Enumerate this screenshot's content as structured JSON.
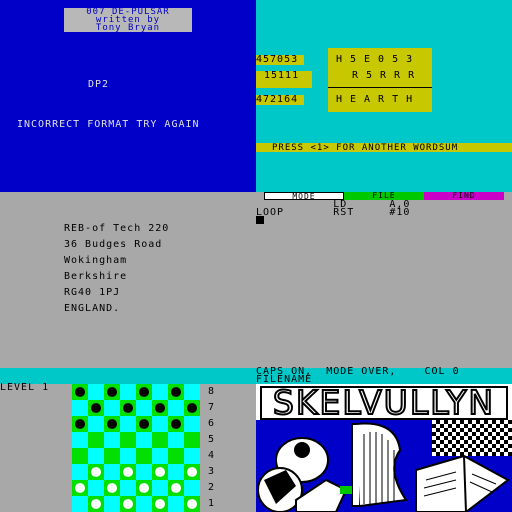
{
  "top_left": {
    "title_lines": [
      "007  DE-PULSAR",
      "written by",
      "Tony Bryan"
    ],
    "label": "DP2",
    "error": "INCORRECT FORMAT TRY AGAIN"
  },
  "top_right": {
    "rows": [
      {
        "number": "457053",
        "word": "H5E053"
      },
      {
        "number": "15111",
        "word": "R5RRR"
      },
      {
        "number": "472164",
        "word": "HEARTH"
      }
    ],
    "prompt": "PRESS <1> FOR ANOTHER WORDSUM"
  },
  "menu": {
    "items": [
      {
        "label": "MODE",
        "color": "#ffffff"
      },
      {
        "label": "FILE",
        "color": "#00c800"
      },
      {
        "label": "FIND",
        "color": "#c800c8"
      }
    ],
    "code_lines": [
      "           LD      A,0",
      "LOOP       RST     #10"
    ]
  },
  "address": {
    "lines": [
      "REB-of Tech 220",
      "36 Budges Road",
      "Wokingham",
      "Berkshire",
      "RG40 1PJ",
      "ENGLAND."
    ]
  },
  "status": {
    "line1": "CAPS ON,  MODE OVER,    COL 0",
    "line2": "FILENAME"
  },
  "game": {
    "level_label": "LEVEL 1",
    "row_numbers": [
      "8",
      "7",
      "6",
      "5",
      "4",
      "3",
      "2",
      "1"
    ],
    "colors": {
      "light": "#00ffff",
      "dark": "#00e000",
      "piece_black": "#000000",
      "piece_white": "#ffffff"
    }
  },
  "logo": {
    "text": "SKELVULLYN"
  }
}
